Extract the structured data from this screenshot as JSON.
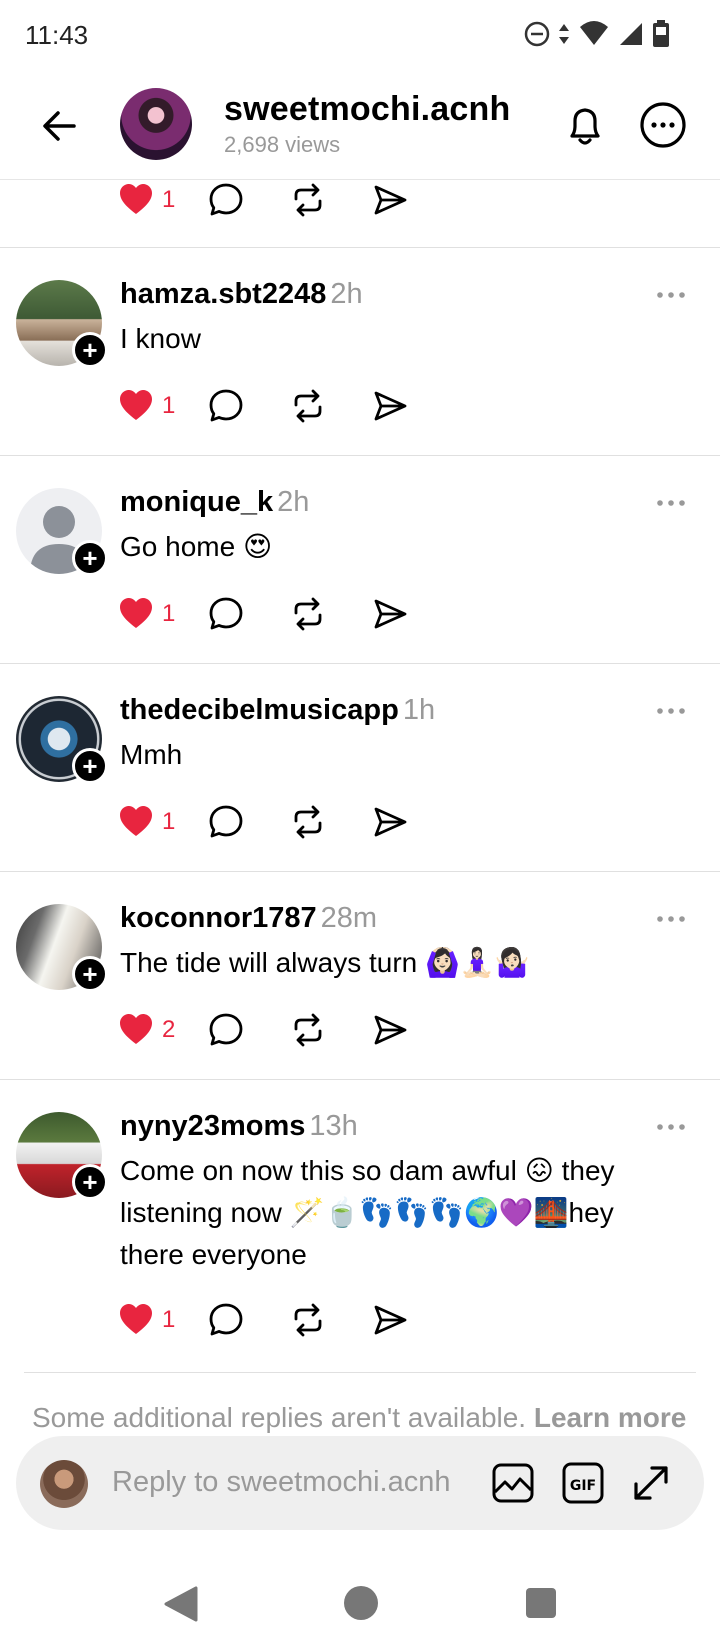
{
  "status_bar": {
    "time": "11:43"
  },
  "header": {
    "title": "sweetmochi.acnh",
    "views": "2,698 views"
  },
  "partial_row": {
    "like_count": "1"
  },
  "replies": [
    {
      "username": "hamza.sbt2248",
      "time": "2h",
      "text": "I know",
      "likes": "1"
    },
    {
      "username": "monique_k",
      "time": "2h",
      "text": "Go home 😍",
      "likes": "1"
    },
    {
      "username": "thedecibelmusicapp",
      "time": "1h",
      "text": "Mmh",
      "likes": "1"
    },
    {
      "username": "koconnor1787",
      "time": "28m",
      "text": "The tide will always turn 🙆🏻‍♀️🧘🏻‍♀️🤷🏻‍♀️",
      "likes": "2"
    },
    {
      "username": "nyny23moms",
      "time": "13h",
      "text": "Come on now this so dam awful 😖 they listening now 🪄🍵👣👣👣🌍💜🌉hey there everyone",
      "likes": "1"
    }
  ],
  "notice": {
    "text": "Some additional replies aren't available.",
    "link": "Learn more"
  },
  "composer": {
    "placeholder": "Reply to sweetmochi.acnh"
  },
  "colors": {
    "like": "#e8253f",
    "text_secondary": "#999999",
    "composer_bg": "#efefef"
  }
}
